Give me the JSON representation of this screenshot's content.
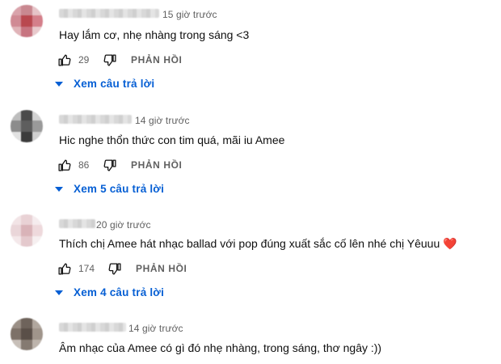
{
  "comments": [
    {
      "timestamp": "15 giờ trước",
      "text": "Hay lắm cơ, nhẹ nhàng trong sáng <3",
      "likes": "29",
      "reply_label": "PHẢN HỒI",
      "view_replies": "Xem câu trả lời",
      "avatar_colors": [
        "#d9a3ab",
        "#c98890",
        "#e6c4c8",
        "#d08a94",
        "#b9484f",
        "#d47f8a",
        "#e0b3b8",
        "#c77480",
        "#e8c9cc"
      ]
    },
    {
      "timestamp": "14 giờ trước",
      "text": "Hic nghe thổn thức con tim quá, mãi iu Amee",
      "likes": "86",
      "reply_label": "PHẢN HỒI",
      "view_replies": "Xem 5 câu trả lời",
      "avatar_colors": [
        "#bdbdbd",
        "#4a4a4a",
        "#d2d2d2",
        "#8c8c8c",
        "#5e5e5e",
        "#9a9a9a",
        "#e2e2e2",
        "#3c3c3c",
        "#cfcfcf"
      ]
    },
    {
      "timestamp": "20 giờ trước",
      "text": "Thích chị Amee hát nhạc ballad với pop đúng xuất sắc cố lên nhé chị Yêuuu",
      "emoji": "❤️",
      "likes": "174",
      "reply_label": "PHẢN HỒI",
      "view_replies": "Xem 4 câu trả lời",
      "avatar_colors": [
        "#f2e4e6",
        "#e9d2d5",
        "#f5ecee",
        "#ead6d9",
        "#d9b3b8",
        "#eed9dc",
        "#f4e8ea",
        "#e4c9cd",
        "#f6eff0"
      ]
    },
    {
      "timestamp": "14 giờ trước",
      "text": "Âm nhạc của Amee có gì đó nhẹ nhàng, trong sáng, thơ ngây :))",
      "avatar_colors": [
        "#9a8f86",
        "#6e635b",
        "#b1a79e",
        "#7d7168",
        "#5a4f48",
        "#a0958b",
        "#c7bfb8",
        "#857a71",
        "#bdb4ac"
      ]
    }
  ]
}
